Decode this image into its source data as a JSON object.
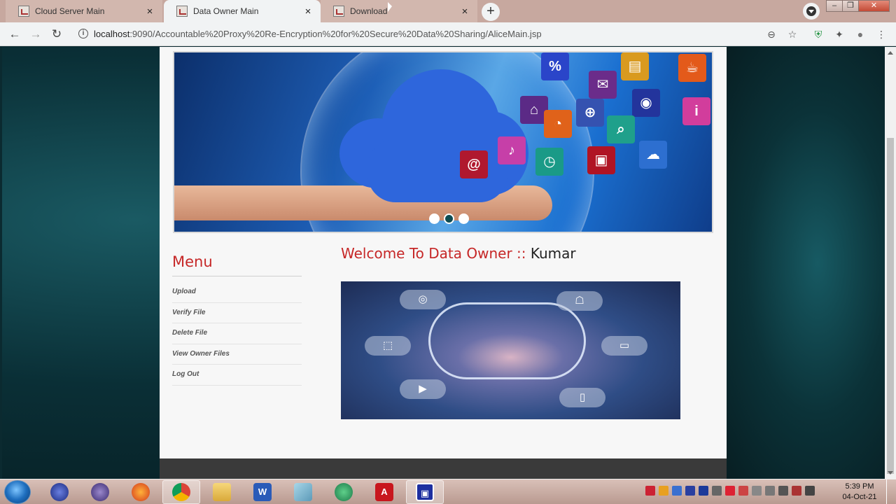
{
  "browser": {
    "tabs": [
      {
        "title": "Cloud Server Main",
        "active": false
      },
      {
        "title": "Data Owner Main",
        "active": true
      },
      {
        "title": "Download",
        "active": false
      }
    ],
    "url_host": "localhost",
    "url_rest": ":9090/Accountable%20Proxy%20Re-Encryption%20for%20Secure%20Data%20Sharing/AliceMain.jsp",
    "icons": {
      "back": "←",
      "forward": "→",
      "reload": "↻",
      "info": "i",
      "zoom": "⊖",
      "star": "☆",
      "shield": "⛨",
      "extensions": "✦",
      "account": "●",
      "more": "⋮",
      "newtab": "+",
      "close": "×",
      "minimize": "–",
      "maximize": "❐",
      "window_close": "✕"
    }
  },
  "page": {
    "banner_tiles": [
      "%",
      "✉",
      "i",
      "⌂",
      "◉",
      "⌕",
      "♪",
      "@",
      "◷",
      "⊕",
      "☁"
    ],
    "carousel_dots": 3,
    "carousel_active": 1,
    "menu": {
      "title": "Menu",
      "items": [
        "Upload",
        "Verify File",
        "Delete File",
        "View Owner Files",
        "Log Out"
      ]
    },
    "welcome": {
      "prefix": "Welcome To Data Owner :: ",
      "name": "Kumar"
    },
    "hero_nodes": [
      "◎",
      "⬚",
      "☖",
      "▭",
      "▶",
      "▯"
    ]
  },
  "taskbar": {
    "apps": [
      "ie-icon",
      "eclipse-icon",
      "firefox-icon",
      "chrome-icon",
      "explorer-icon",
      "word-icon",
      "notepad-icon",
      "vpn-icon",
      "pdf-icon",
      "app-icon"
    ],
    "time": "5:39 PM",
    "date": "04-Oct-21"
  },
  "colors": {
    "accent_red": "#c62727",
    "page_bg": "#f7f7f7",
    "footer": "#3a3a3a"
  }
}
